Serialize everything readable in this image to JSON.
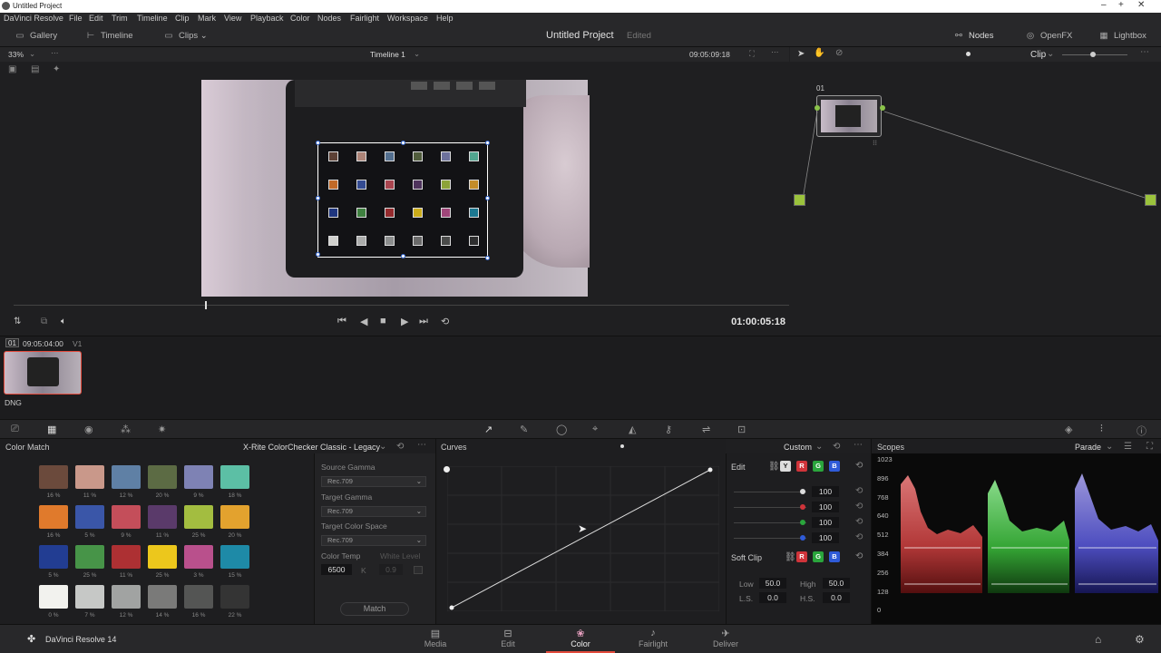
{
  "window": {
    "title": "Untitled Project"
  },
  "menu": [
    "DaVinci Resolve",
    "File",
    "Edit",
    "Trim",
    "Timeline",
    "Clip",
    "Mark",
    "View",
    "Playback",
    "Color",
    "Nodes",
    "Fairlight",
    "Workspace",
    "Help"
  ],
  "toolbar": {
    "gallery": "Gallery",
    "timeline": "Timeline",
    "clips": "Clips",
    "project_name": "Untitled Project",
    "project_status": "Edited",
    "nodes": "Nodes",
    "openfx": "OpenFX",
    "lightbox": "Lightbox"
  },
  "viewer": {
    "zoom": "33%",
    "timeline_name": "Timeline 1",
    "source_tc": "09:05:09:18",
    "record_tc": "01:00:05:18"
  },
  "node_panel": {
    "mode": "Clip",
    "node_label": "01"
  },
  "clip_strip": {
    "clip_number": "01",
    "clip_tc": "09:05:04:00",
    "track": "V1",
    "clip_format": "DNG"
  },
  "color_match": {
    "title": "Color Match",
    "chart": "X-Rite ColorChecker Classic - Legacy",
    "swatches": [
      {
        "color": "#6b4a3c",
        "pct": "16 %"
      },
      {
        "color": "#c9988a",
        "pct": "11 %"
      },
      {
        "color": "#5f80a5",
        "pct": "12 %"
      },
      {
        "color": "#5c6b44",
        "pct": "20 %"
      },
      {
        "color": "#7e82b4",
        "pct": "9 %"
      },
      {
        "color": "#5cbfa5",
        "pct": "18 %"
      },
      {
        "color": "#e07a2c",
        "pct": "16 %"
      },
      {
        "color": "#3a56a8",
        "pct": "5 %"
      },
      {
        "color": "#c44e5a",
        "pct": "9 %"
      },
      {
        "color": "#5a3a6a",
        "pct": "11 %"
      },
      {
        "color": "#a3bd40",
        "pct": "25 %"
      },
      {
        "color": "#e3a22e",
        "pct": "20 %"
      },
      {
        "color": "#223d92",
        "pct": "5 %"
      },
      {
        "color": "#479448",
        "pct": "25 %"
      },
      {
        "color": "#ad3033",
        "pct": "11 %"
      },
      {
        "color": "#ecc71c",
        "pct": "25 %"
      },
      {
        "color": "#b9508c",
        "pct": "3 %"
      },
      {
        "color": "#1e8aa7",
        "pct": "15 %"
      },
      {
        "color": "#f2f2ee",
        "pct": "0 %"
      },
      {
        "color": "#c6c8c6",
        "pct": "7 %"
      },
      {
        "color": "#a1a3a2",
        "pct": "12 %"
      },
      {
        "color": "#7a7a79",
        "pct": "14 %"
      },
      {
        "color": "#545554",
        "pct": "16 %"
      },
      {
        "color": "#343434",
        "pct": "22 %"
      }
    ],
    "source_gamma_label": "Source Gamma",
    "source_gamma": "Rec.709",
    "target_gamma_label": "Target Gamma",
    "target_gamma": "Rec.709",
    "target_cs_label": "Target Color Space",
    "target_cs": "Rec.709",
    "color_temp_label": "Color Temp",
    "white_level_label": "White Level",
    "color_temp": "6500",
    "color_temp_unit": "K",
    "white_level": "0.9",
    "match_button": "Match"
  },
  "curves": {
    "title": "Curves",
    "mode": "Custom"
  },
  "edit": {
    "label": "Edit",
    "channels": [
      "Y",
      "R",
      "G",
      "B"
    ],
    "values": [
      "100",
      "100",
      "100",
      "100"
    ],
    "soft_clip_label": "Soft Clip",
    "low_label": "Low",
    "low": "50.0",
    "high_label": "High",
    "high": "50.0",
    "ls_label": "L.S.",
    "ls": "0.0",
    "hs_label": "H.S.",
    "hs": "0.0"
  },
  "scopes": {
    "title": "Scopes",
    "mode": "Parade",
    "scale": [
      "1023",
      "896",
      "768",
      "640",
      "512",
      "384",
      "256",
      "128",
      "0"
    ]
  },
  "pages": [
    "Media",
    "Edit",
    "Color",
    "Fairlight",
    "Deliver"
  ],
  "app_name": "DaVinci Resolve 14",
  "colors": {
    "accent": "#e24a3c",
    "selected_page": "#e24a3c"
  }
}
